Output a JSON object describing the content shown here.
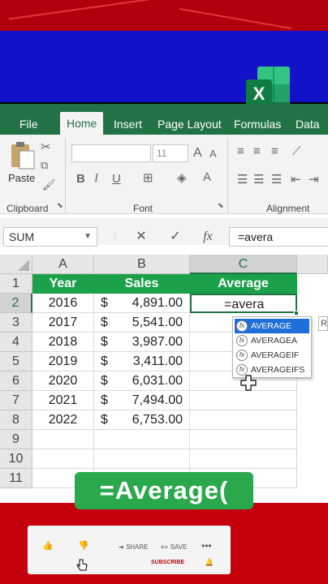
{
  "app": {
    "menu": [
      "File",
      "Home",
      "Insert",
      "Page Layout",
      "Formulas",
      "Data"
    ],
    "active_tab": "Home"
  },
  "ribbon": {
    "paste_label": "Paste",
    "font_size": "11",
    "groups": {
      "clipboard": "Clipboard",
      "font": "Font",
      "alignment": "Alignment"
    },
    "format_buttons": [
      "B",
      "I",
      "U"
    ],
    "grow_font": "A",
    "shrink_font": "A",
    "font_color": "A"
  },
  "formula_bar": {
    "name_box": "SUM",
    "cancel": "✕",
    "enter": "✓",
    "fx": "fx",
    "content": "=avera"
  },
  "sheet": {
    "columns": [
      "A",
      "B",
      "C"
    ],
    "rows": [
      "1",
      "2",
      "3",
      "4",
      "5",
      "6",
      "7",
      "8",
      "9",
      "10",
      "11"
    ],
    "header": {
      "year": "Year",
      "sales": "Sales",
      "average": "Average"
    },
    "data": [
      {
        "year": "2016",
        "currency": "$",
        "sales": "4,891.00"
      },
      {
        "year": "2017",
        "currency": "$",
        "sales": "5,541.00"
      },
      {
        "year": "2018",
        "currency": "$",
        "sales": "3,987.00"
      },
      {
        "year": "2019",
        "currency": "$",
        "sales": "3,411.00"
      },
      {
        "year": "2020",
        "currency": "$",
        "sales": "6,031.00"
      },
      {
        "year": "2021",
        "currency": "$",
        "sales": "7,494.00"
      },
      {
        "year": "2022",
        "currency": "$",
        "sales": "6,753.00"
      }
    ],
    "active_cell_text": "=avera"
  },
  "autocomplete": {
    "items": [
      "AVERAGE",
      "AVERAGEA",
      "AVERAGEIF",
      "AVERAGEIFS"
    ],
    "fx_glyph": "fx",
    "tail": "R"
  },
  "banner": {
    "text": "=Average("
  },
  "youtube": {
    "share": "SHARE",
    "save": "SAVE",
    "subscribe": "SUBSCRIBE"
  },
  "colors": {
    "excel_green": "#217346",
    "header_green": "#1aa14a",
    "blue_band": "#1212c8",
    "red_band": "#c4000c"
  }
}
